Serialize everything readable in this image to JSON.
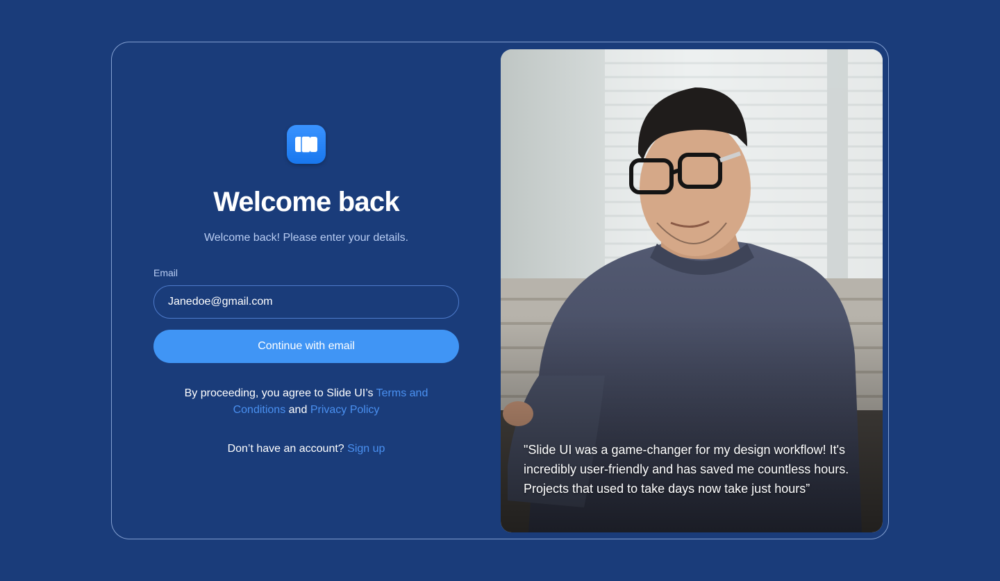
{
  "login": {
    "title": "Welcome back",
    "subtitle": "Welcome back! Please enter your details.",
    "email_label": "Email",
    "email_value": "Janedoe@gmail.com",
    "continue_label": "Continue with email",
    "terms_prefix": "By proceeding, you agree to Slide UI’s",
    "terms_link": "Terms and",
    "terms_link_2": "Conditions",
    "terms_and": "and",
    "privacy_link": "Privacy Policy",
    "no_account_text": "Don’t have an account?",
    "signup_link": "Sign up"
  },
  "testimonial": {
    "quote": "\"Slide UI was a game-changer for my design workflow! It's incredibly user-friendly and has saved me countless hours. Projects that used to take days now take just hours”",
    "photo": "portrait-photo"
  },
  "icons": {
    "logo": "slide-ui-logo-icon"
  },
  "colors": {
    "background": "#1a3c7a",
    "accent": "#4095f5",
    "link": "#4a90f0",
    "muted_text": "#b9cdf3"
  }
}
